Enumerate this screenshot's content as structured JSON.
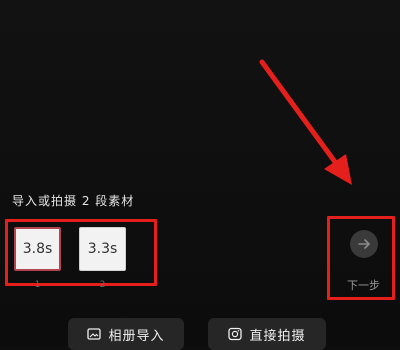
{
  "hint_text": "导入或拍摄 2 段素材",
  "clips": [
    {
      "duration": "3.8s",
      "index": "1"
    },
    {
      "duration": "3.3s",
      "index": "2"
    }
  ],
  "next": {
    "label": "下一步",
    "icon": "arrow-right-icon"
  },
  "bottom": {
    "album_label": "相册导入",
    "album_icon": "image-icon",
    "shoot_label": "直接拍摄",
    "shoot_icon": "camera-icon"
  },
  "colors": {
    "background": "#0e0e0e",
    "annotation": "#e5201c",
    "selected_clip_border": "#b24550",
    "button_bg": "#262626"
  }
}
